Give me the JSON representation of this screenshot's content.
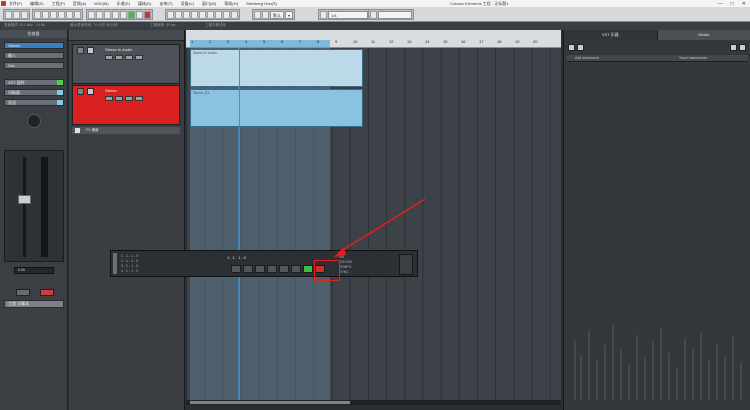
{
  "window": {
    "title": "Cubase Elements 工程 - 无标题1",
    "menu": [
      "文件(F)",
      "编辑(E)",
      "工程(P)",
      "音频(A)",
      "MIDI(M)",
      "乐谱(S)",
      "媒体(D)",
      "走带(T)",
      "设备(V)",
      "窗口(W)",
      "帮助(H)",
      "Steinberg Hub(S)"
    ],
    "controls": [
      "—",
      "□",
      "✕"
    ]
  },
  "toolbar": {
    "fields": [
      "默认",
      "▾",
      "1/4"
    ]
  },
  "statusline": {
    "items": [
      "录音格式 44.1 kHz - 24 Bit",
      "最大录音时间: 74 小时 58 分钟",
      "工程帧率: 30 fps",
      "工程平移法则"
    ]
  },
  "inspector": {
    "title": "检查器",
    "rows": [
      "Stereo",
      "输入",
      "Out",
      "VST 插件",
      "均衡器",
      "发送"
    ],
    "value": "0.00",
    "bottom": "工程 记事本"
  },
  "tracks": [
    {
      "name": "Stereo In Audio"
    },
    {
      "name": "Stereo"
    }
  ],
  "fx_row": {
    "label": "FX 通道"
  },
  "ruler": {
    "ticks": [
      "1",
      "2",
      "3",
      "4",
      "5",
      "6",
      "7",
      "8",
      "9",
      "10",
      "11",
      "12",
      "13",
      "14",
      "15",
      "16",
      "17",
      "18",
      "19",
      "20"
    ]
  },
  "parts": [
    {
      "label": "Stereo In Audio"
    },
    {
      "label": "Stereo_01"
    }
  ],
  "transport": {
    "list": [
      "1 - 1 - 1 - 0",
      "2 - 1 - 1 - 0",
      "3 - 1 - 1 - 0",
      "4 - 1 - 1 - 0"
    ],
    "position": "1 . 1 . 1 . 0",
    "bars": "2 . 1 . 1 . 0",
    "sig": [
      "4/4",
      "120.000",
      "TEMPO",
      "SYNC"
    ],
    "selected_button": "record"
  },
  "right_zone": {
    "tabs": [
      "VST 乐器",
      "Media"
    ],
    "columns": [
      "Add Instrument",
      "Track Instruments"
    ]
  },
  "colors": {
    "record_accent": "#d22b2b",
    "play_accent": "#3dbd3d",
    "part_color": "#8ac3df"
  }
}
